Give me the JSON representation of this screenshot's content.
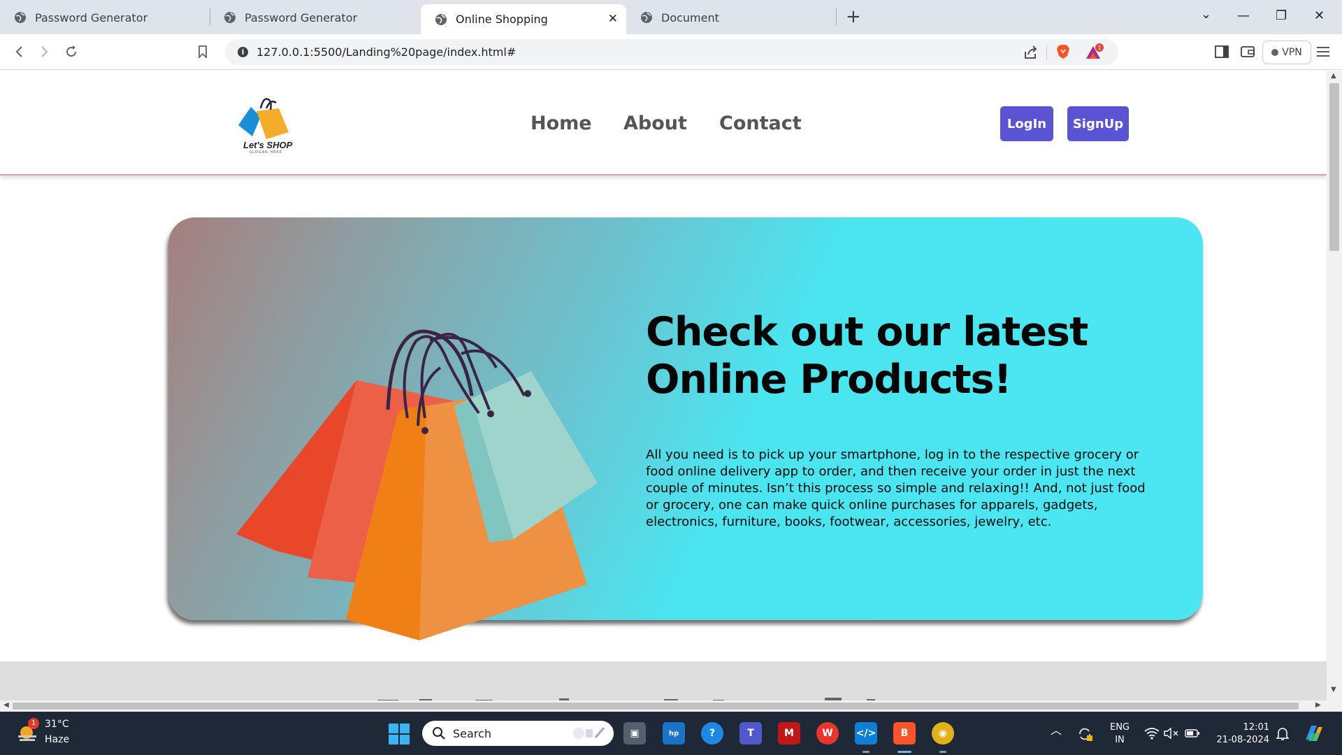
{
  "browser": {
    "tabs": [
      {
        "title": "Password Generator",
        "active": false
      },
      {
        "title": "Password Generator",
        "active": false
      },
      {
        "title": "Online Shopping",
        "active": true
      },
      {
        "title": "Document",
        "active": false
      }
    ],
    "url": "127.0.0.1:5500/Landing%20page/index.html#",
    "vpn_label": "VPN",
    "notification_count": "1"
  },
  "site": {
    "logo_text": "Let's SHOP",
    "logo_slogan": "SLOGAN HERE",
    "nav": [
      "Home",
      "About",
      "Contact"
    ],
    "login_label": "LogIn",
    "signup_label": "SignUp"
  },
  "hero": {
    "title_line1": "Check out our latest",
    "title_line2": "Online Products!",
    "description": "All you need is to pick up your smartphone, log in to the respective grocery or food online delivery app to order, and then receive your order in just the next couple of minutes. Isn’t this process so simple and relaxing!! And, not just food or grocery, one can make quick online purchases for apparels, gadgets, electronics, furniture, books, footwear, accessories, jewelry, etc."
  },
  "taskbar": {
    "weather_temp": "31°C",
    "weather_desc": "Haze",
    "weather_badge": "1",
    "search_label": "Search",
    "language_line1": "ENG",
    "language_line2": "IN",
    "time": "12:01",
    "date": "21-08-2024"
  },
  "colors": {
    "button": "#5a54d2",
    "hero_start": "#a67f7e",
    "hero_end": "#4be6f2"
  }
}
